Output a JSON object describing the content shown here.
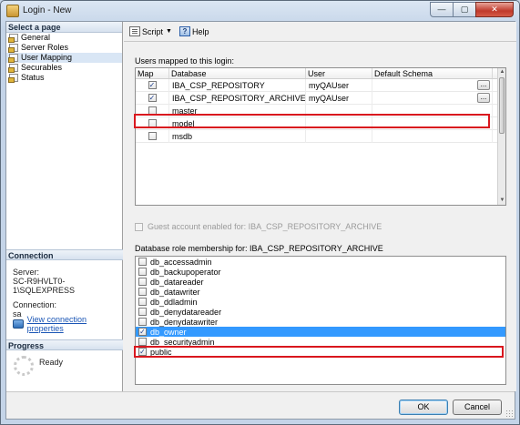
{
  "window": {
    "title": "Login - New",
    "buttons": {
      "minimize": "—",
      "maximize": "▢",
      "close": "✕"
    }
  },
  "left": {
    "select_header": "Select a page",
    "pages": [
      {
        "label": "General",
        "icon": "page-icon"
      },
      {
        "label": "Server Roles",
        "icon": "page-icon"
      },
      {
        "label": "User Mapping",
        "icon": "page-icon"
      },
      {
        "label": "Securables",
        "icon": "page-icon"
      },
      {
        "label": "Status",
        "icon": "page-icon"
      }
    ],
    "connection_header": "Connection",
    "server_label": "Server:",
    "server_value": "SC-R9HVLT0-1\\SQLEXPRESS",
    "connection_label": "Connection:",
    "connection_value": "sa",
    "view_props_link": "View connection properties",
    "progress_header": "Progress",
    "progress_status": "Ready"
  },
  "toolbar": {
    "script_label": "Script",
    "help_label": "Help"
  },
  "users_mapped": {
    "label": "Users mapped to this login:",
    "columns": [
      "Map",
      "Database",
      "User",
      "Default Schema"
    ],
    "rows": [
      {
        "map": true,
        "database": "IBA_CSP_REPOSITORY",
        "user": "myQAUser",
        "schema": "",
        "ellipsis": "..."
      },
      {
        "map": true,
        "database": "IBA_CSP_REPOSITORY_ARCHIVE",
        "user": "myQAUser",
        "schema": "",
        "ellipsis": "..."
      },
      {
        "map": false,
        "database": "master",
        "user": "",
        "schema": ""
      },
      {
        "map": false,
        "database": "model",
        "user": "",
        "schema": ""
      },
      {
        "map": false,
        "database": "msdb",
        "user": "",
        "schema": ""
      }
    ]
  },
  "guest": {
    "label": "Guest account enabled for: IBA_CSP_REPOSITORY_ARCHIVE",
    "checked": false,
    "enabled": false
  },
  "roles": {
    "label": "Database role membership for: IBA_CSP_REPOSITORY_ARCHIVE",
    "items": [
      {
        "name": "db_accessadmin",
        "checked": false
      },
      {
        "name": "db_backupoperator",
        "checked": false
      },
      {
        "name": "db_datareader",
        "checked": false
      },
      {
        "name": "db_datawriter",
        "checked": false
      },
      {
        "name": "db_ddladmin",
        "checked": false
      },
      {
        "name": "db_denydatareader",
        "checked": false
      },
      {
        "name": "db_denydatawriter",
        "checked": false
      },
      {
        "name": "db_owner",
        "checked": true,
        "selected": true
      },
      {
        "name": "db_securityadmin",
        "checked": false
      },
      {
        "name": "public",
        "checked": true
      }
    ]
  },
  "buttons": {
    "ok": "OK",
    "cancel": "Cancel"
  },
  "colors": {
    "highlight_border": "#d9171e",
    "selection": "#3399ff",
    "link": "#1a55b5"
  }
}
